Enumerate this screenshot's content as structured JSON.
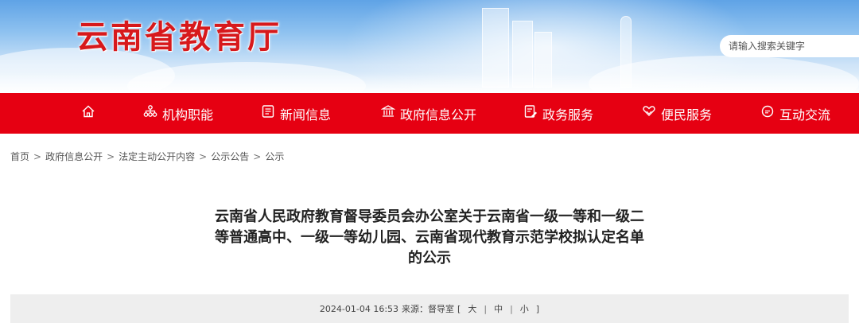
{
  "header": {
    "site_title": "云南省教育厅",
    "search_placeholder": "请输入搜索关键字"
  },
  "nav": {
    "items": [
      {
        "label": "",
        "icon": "home-icon"
      },
      {
        "label": "机构职能",
        "icon": "org-icon"
      },
      {
        "label": "新闻信息",
        "icon": "news-icon"
      },
      {
        "label": "政府信息公开",
        "icon": "government-icon"
      },
      {
        "label": "政务服务",
        "icon": "service-icon"
      },
      {
        "label": "便民服务",
        "icon": "heart-hand-icon"
      },
      {
        "label": "互动交流",
        "icon": "chat-icon"
      }
    ]
  },
  "breadcrumb": [
    "首页",
    "政府信息公开",
    "法定主动公开内容",
    "公示公告",
    "公示"
  ],
  "breadcrumb_separator": ">",
  "article": {
    "title_lines": [
      "云南省人民政府教育督导委员会办公室关于云南省一级一等和一级二",
      "等普通高中、一级一等幼儿园、云南省现代教育示范学校拟认定名单",
      "的公示"
    ],
    "meta": {
      "datetime": "2024-01-04 16:53",
      "source_label": "来源：督导室",
      "font_bracket_open": "[",
      "font_large": "大",
      "font_medium": "中",
      "font_small": "小",
      "font_bracket_close": "]",
      "font_separator": "|"
    }
  },
  "colors": {
    "nav_red": "#e60012",
    "title_red": "#d7191c",
    "meta_bg": "#eeeeee"
  }
}
